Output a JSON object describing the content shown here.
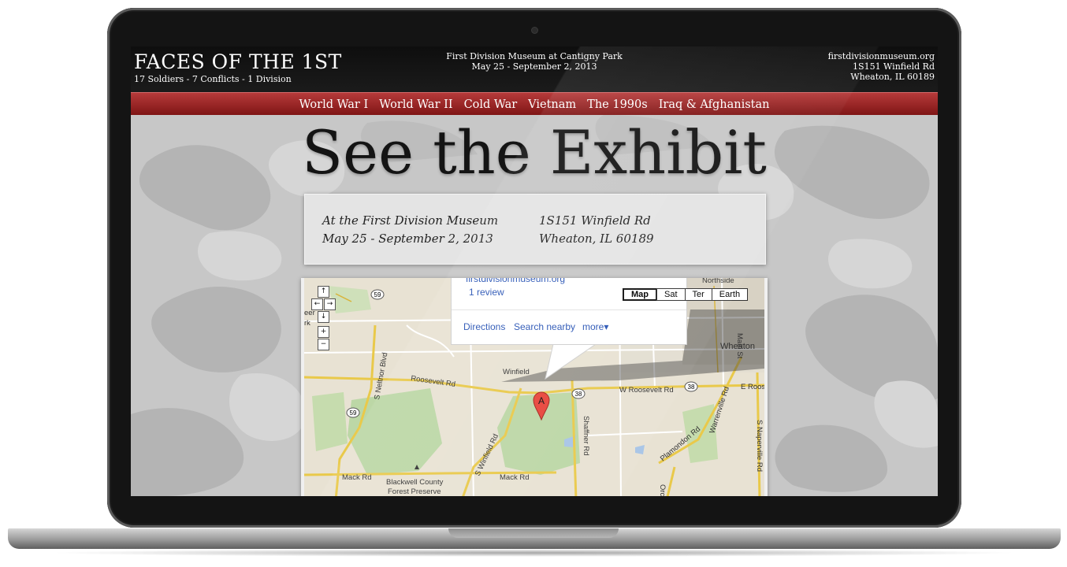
{
  "header": {
    "title": "FACES OF THE 1ST",
    "tagline": "17 Soldiers - 7 Conflicts - 1 Division",
    "venue_line1": "First Division Museum at Cantigny Park",
    "venue_line2": "May 25 - September 2, 2013",
    "site": "firstdivisionmuseum.org",
    "address1": "1S151 Winfield Rd",
    "address2": "Wheaton, IL 60189"
  },
  "nav": {
    "items": [
      "World War I",
      "World War II",
      "Cold War",
      "Vietnam",
      "The 1990s",
      "Iraq & Afghanistan"
    ]
  },
  "hero": {
    "title": "See the Exhibit"
  },
  "info": {
    "left_line1": "At the First Division Museum",
    "left_line2": "May 25 - September 2, 2013",
    "right_line1": "1S151 Winfield Rd",
    "right_line2": "Wheaton, IL 60189"
  },
  "map": {
    "controls": {
      "up": "↑",
      "left": "←",
      "right": "→",
      "down": "↓",
      "zoom_in": "+",
      "zoom_out": "−"
    },
    "types": [
      "Map",
      "Sat",
      "Ter",
      "Earth"
    ],
    "selected_type": "Map",
    "bubble": {
      "site": "firstdivisionmuseum.org",
      "reviews": "1 review",
      "directions": "Directions",
      "search_nearby": "Search nearby",
      "more": "more▾"
    },
    "marker": "A",
    "labels": {
      "northside": "Northside",
      "main_st": "Main St",
      "wheaton": "Wheaton",
      "winfield": "Winfield",
      "roosevelt": "Roosevelt Rd",
      "w_roosevelt": "W Roosevelt Rd",
      "e_roos": "E Roos",
      "s_neltnor": "S Neltnor Blvd",
      "s_winfield": "S Winfield Rd",
      "shaffner": "Shaffner Rd",
      "plamondon": "Plamondon Rd",
      "warrenville": "Warrenville Rd",
      "s_naperville": "S Naperville Rd",
      "mack1": "Mack Rd",
      "mack2": "Mack Rd",
      "blackwell1": "Blackwell County",
      "blackwell2": "Forest Preserve",
      "orcha": "Orcha",
      "eer": "eer",
      "rk": "rk",
      "route59a": "59",
      "route59b": "59",
      "route38a": "38",
      "route38b": "38"
    }
  },
  "colors": {
    "nav_top": "#b63a3a",
    "nav_bottom": "#7d1414",
    "header_bg": "#111111",
    "link_blue": "#2a55b5"
  }
}
